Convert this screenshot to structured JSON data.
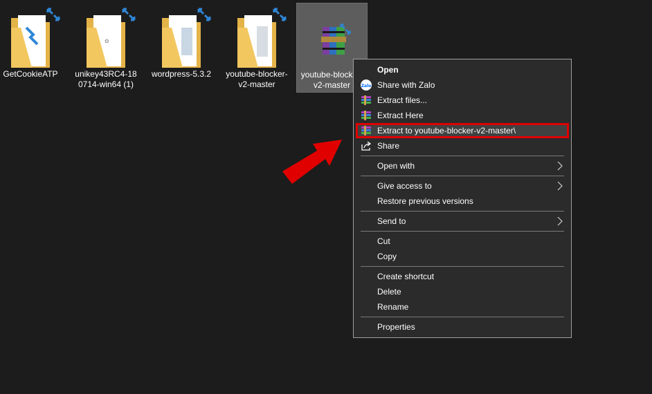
{
  "desktop": {
    "icons": [
      {
        "label": "GetCookieATP",
        "icon": "folder-icon"
      },
      {
        "label": "unikey43RC4-180714-win64 (1)",
        "icon": "folder-icon"
      },
      {
        "label": "wordpress-5.3.2",
        "icon": "folder-icon"
      },
      {
        "label": "youtube-blocker-v2-master",
        "icon": "folder-icon"
      },
      {
        "label": "youtube-blocker-v2-master",
        "icon": "winrar-archive-icon"
      }
    ]
  },
  "context_menu": {
    "items": [
      {
        "label": "Open",
        "bold": true
      },
      {
        "label": "Share with Zalo",
        "icon": "zalo-icon"
      },
      {
        "label": "Extract files...",
        "icon": "winrar-icon"
      },
      {
        "label": "Extract Here",
        "icon": "winrar-icon"
      },
      {
        "label": "Extract to youtube-blocker-v2-master\\",
        "icon": "winrar-icon",
        "highlighted": true
      },
      {
        "label": "Share",
        "icon": "share-icon"
      },
      {
        "label": "Open with",
        "submenu": true
      },
      {
        "label": "Give access to",
        "submenu": true
      },
      {
        "label": "Restore previous versions"
      },
      {
        "label": "Send to",
        "submenu": true
      },
      {
        "label": "Cut"
      },
      {
        "label": "Copy"
      },
      {
        "label": "Create shortcut"
      },
      {
        "label": "Delete"
      },
      {
        "label": "Rename"
      },
      {
        "label": "Properties"
      }
    ]
  },
  "colors": {
    "background": "#1c1c1c",
    "menu_bg": "#2b2b2b",
    "highlight_border": "#e00000",
    "arrow_red": "#e00000",
    "folder": "#f3c75f",
    "sync_badge": "#2f86d6"
  }
}
